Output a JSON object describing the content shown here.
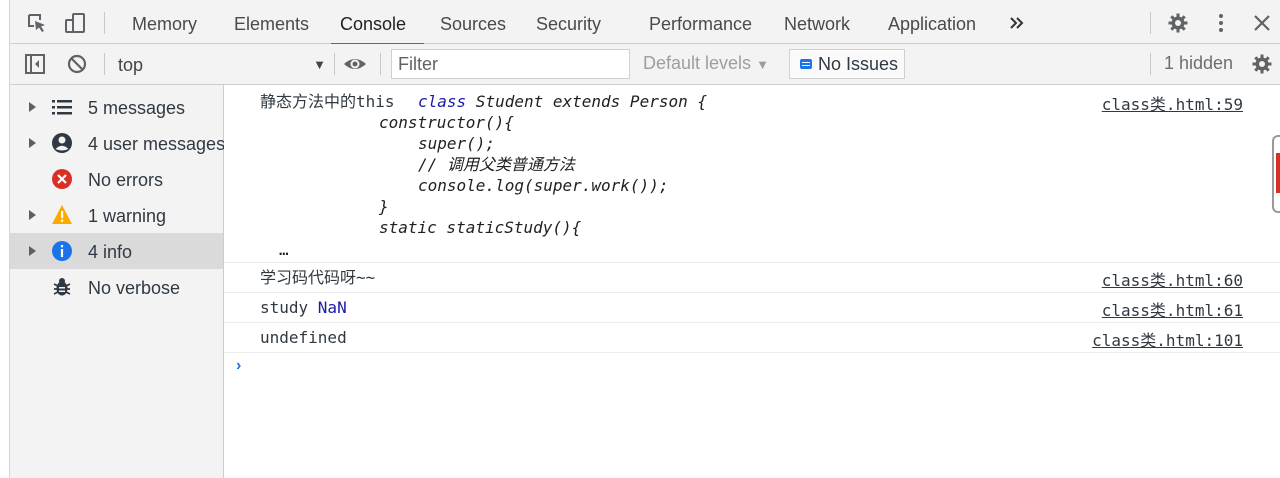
{
  "tabs": [
    {
      "label": "Memory"
    },
    {
      "label": "Elements"
    },
    {
      "label": "Console"
    },
    {
      "label": "Sources"
    },
    {
      "label": "Security"
    },
    {
      "label": "Performance"
    },
    {
      "label": "Network"
    },
    {
      "label": "Application"
    }
  ],
  "active_tab": "Console",
  "toolbar": {
    "context": "top",
    "filter_placeholder": "Filter",
    "levels_label": "Default levels",
    "issues_label": "No Issues",
    "hidden_label": "1 hidden"
  },
  "sidebar": {
    "items": [
      {
        "label": "5 messages",
        "icon": "list-icon"
      },
      {
        "label": "4 user messages",
        "icon": "user-icon"
      },
      {
        "label": "No errors",
        "icon": "error-icon"
      },
      {
        "label": "1 warning",
        "icon": "warning-icon"
      },
      {
        "label": "4 info",
        "icon": "info-icon",
        "selected": true
      },
      {
        "label": "No verbose",
        "icon": "bug-icon"
      }
    ]
  },
  "console": {
    "messages": [
      {
        "prefix": "静态方法中的this ",
        "code": [
          {
            "kw": "class",
            "rest": " Student extends Person {"
          },
          {
            "text": "constructor(){"
          },
          {
            "text": "super();"
          },
          {
            "text": "// 调用父类普通方法"
          },
          {
            "text": "console.log(super.work());"
          },
          {
            "text": "}"
          },
          {
            "text": "static staticStudy(){"
          }
        ],
        "ellipsis": "…",
        "source": "class类.html:59"
      },
      {
        "text": "学习码代码呀~~",
        "source": "class类.html:60"
      },
      {
        "text": "study ",
        "value": "NaN",
        "source": "class类.html:61"
      },
      {
        "text": "undefined",
        "source": "class类.html:101"
      }
    ],
    "prompt": "›"
  },
  "colors": {
    "accent": "#1a73e8",
    "error": "#d93025",
    "warning": "#f9ab00",
    "info": "#1a73e8"
  }
}
